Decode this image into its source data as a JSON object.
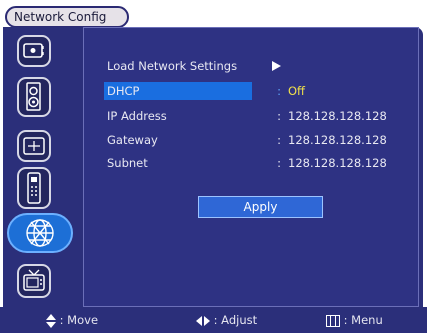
{
  "title": "Network Config",
  "sidebar": {
    "items": [
      {
        "icon": "display-icon"
      },
      {
        "icon": "audio-icon"
      },
      {
        "icon": "position-icon"
      },
      {
        "icon": "remote-icon"
      },
      {
        "icon": "network-icon",
        "selected": true
      },
      {
        "icon": "tv-icon"
      }
    ]
  },
  "menu": {
    "load_label": "Load Network Settings",
    "dhcp": {
      "label": "DHCP",
      "colon": ":",
      "value": "Off"
    },
    "ip": {
      "label": "IP Address",
      "colon": ":",
      "value": "128.128.128.128"
    },
    "gateway": {
      "label": "Gateway",
      "colon": ":",
      "value": "128.128.128.128"
    },
    "subnet": {
      "label": "Subnet",
      "colon": ":",
      "value": "128.128.128.128"
    },
    "apply_label": "Apply"
  },
  "footer": {
    "move": ": Move",
    "adjust": ": Adjust",
    "menu": ": Menu"
  },
  "colors": {
    "panel": "#2b2f7a",
    "highlight": "#1a6ee0",
    "value_selected": "#f1e14a"
  }
}
